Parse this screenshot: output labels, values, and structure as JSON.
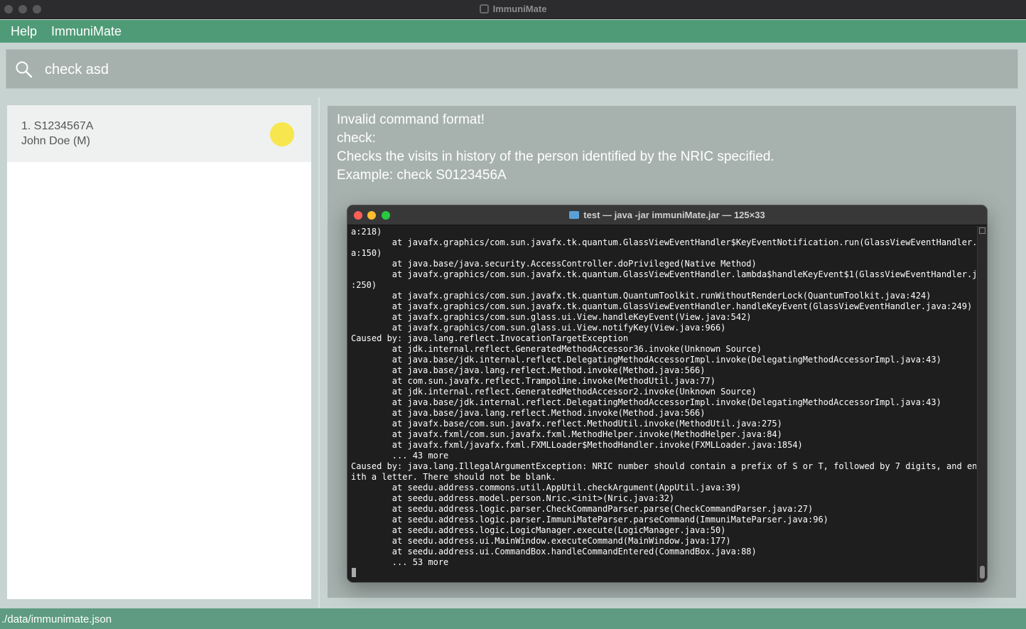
{
  "window": {
    "title": "ImmuniMate"
  },
  "menu": {
    "items": [
      "Help",
      "ImmuniMate"
    ]
  },
  "command_box": {
    "value": "check asd"
  },
  "person_list": [
    {
      "index_id": "1. S1234567A",
      "name_sex": "John Doe (M)",
      "status_color": "#f7e64d"
    }
  ],
  "result": {
    "lines": [
      "Invalid command format!",
      "check:",
      "Checks the visits in history of the person identified by the NRIC specified.",
      "Example: check S0123456A"
    ]
  },
  "terminal": {
    "title": "test — java -jar immuniMate.jar — 125×33",
    "output": "a:218)\n        at javafx.graphics/com.sun.javafx.tk.quantum.GlassViewEventHandler$KeyEventNotification.run(GlassViewEventHandler.jav\na:150)\n        at java.base/java.security.AccessController.doPrivileged(Native Method)\n        at javafx.graphics/com.sun.javafx.tk.quantum.GlassViewEventHandler.lambda$handleKeyEvent$1(GlassViewEventHandler.java\n:250)\n        at javafx.graphics/com.sun.javafx.tk.quantum.QuantumToolkit.runWithoutRenderLock(QuantumToolkit.java:424)\n        at javafx.graphics/com.sun.javafx.tk.quantum.GlassViewEventHandler.handleKeyEvent(GlassViewEventHandler.java:249)\n        at javafx.graphics/com.sun.glass.ui.View.handleKeyEvent(View.java:542)\n        at javafx.graphics/com.sun.glass.ui.View.notifyKey(View.java:966)\nCaused by: java.lang.reflect.InvocationTargetException\n        at jdk.internal.reflect.GeneratedMethodAccessor36.invoke(Unknown Source)\n        at java.base/jdk.internal.reflect.DelegatingMethodAccessorImpl.invoke(DelegatingMethodAccessorImpl.java:43)\n        at java.base/java.lang.reflect.Method.invoke(Method.java:566)\n        at com.sun.javafx.reflect.Trampoline.invoke(MethodUtil.java:77)\n        at jdk.internal.reflect.GeneratedMethodAccessor2.invoke(Unknown Source)\n        at java.base/jdk.internal.reflect.DelegatingMethodAccessorImpl.invoke(DelegatingMethodAccessorImpl.java:43)\n        at java.base/java.lang.reflect.Method.invoke(Method.java:566)\n        at javafx.base/com.sun.javafx.reflect.MethodUtil.invoke(MethodUtil.java:275)\n        at javafx.fxml/com.sun.javafx.fxml.MethodHelper.invoke(MethodHelper.java:84)\n        at javafx.fxml/javafx.fxml.FXMLLoader$MethodHandler.invoke(FXMLLoader.java:1854)\n        ... 43 more\nCaused by: java.lang.IllegalArgumentException: NRIC number should contain a prefix of S or T, followed by 7 digits, and end w\nith a letter. There should not be blank.\n        at seedu.address.commons.util.AppUtil.checkArgument(AppUtil.java:39)\n        at seedu.address.model.person.Nric.<init>(Nric.java:32)\n        at seedu.address.logic.parser.CheckCommandParser.parse(CheckCommandParser.java:27)\n        at seedu.address.logic.parser.ImmuniMateParser.parseCommand(ImmuniMateParser.java:96)\n        at seedu.address.logic.LogicManager.execute(LogicManager.java:50)\n        at seedu.address.ui.MainWindow.executeCommand(MainWindow.java:177)\n        at seedu.address.ui.CommandBox.handleCommandEntered(CommandBox.java:88)\n        ... 53 more"
  },
  "status_bar": {
    "path": "./data/immunimate.json"
  },
  "icons": {
    "search": "search-icon",
    "app": "app-icon",
    "folder": "folder-icon"
  },
  "colors": {
    "accent_green": "#4f9b77",
    "status_green": "#5e9b82",
    "traffic_red": "#fe5f57",
    "traffic_yellow": "#febc2e",
    "traffic_green": "#28c840"
  }
}
